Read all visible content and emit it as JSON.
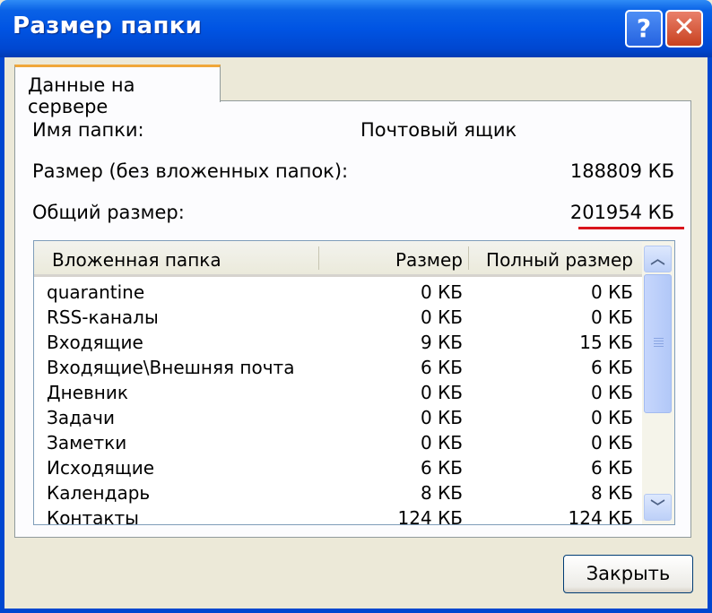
{
  "window": {
    "title": "Размер папки",
    "help_label": "?",
    "close_label": "✕"
  },
  "tab": {
    "label": "Данные на сервере"
  },
  "info": {
    "folder_name_label": "Имя папки:",
    "folder_name_value": "Почтовый ящик",
    "size_label": "Размер (без вложенных папок):",
    "size_value": "188809 КБ",
    "total_label": "Общий размер:",
    "total_value": "201954 КБ"
  },
  "table": {
    "headers": {
      "name": "Вложенная папка",
      "size": "Размер",
      "full": "Полный размер"
    },
    "rows": [
      {
        "name": "quarantine",
        "size": "0 КБ",
        "full": "0 КБ"
      },
      {
        "name": "RSS-каналы",
        "size": "0 КБ",
        "full": "0 КБ"
      },
      {
        "name": "Входящие",
        "size": "9 КБ",
        "full": "15 КБ"
      },
      {
        "name": "Входящие\\Внешняя почта",
        "size": "6 КБ",
        "full": "6 КБ"
      },
      {
        "name": "Дневник",
        "size": "0 КБ",
        "full": "0 КБ"
      },
      {
        "name": "Задачи",
        "size": "0 КБ",
        "full": "0 КБ"
      },
      {
        "name": "Заметки",
        "size": "0 КБ",
        "full": "0 КБ"
      },
      {
        "name": "Исходящие",
        "size": "6 КБ",
        "full": "6 КБ"
      },
      {
        "name": "Календарь",
        "size": "8 КБ",
        "full": "8 КБ"
      },
      {
        "name": "Контакты",
        "size": "124 КБ",
        "full": "124 КБ"
      }
    ]
  },
  "scrollbar": {
    "up_label": "︿",
    "down_label": "﹀"
  },
  "footer": {
    "close_button": "Закрыть"
  },
  "colors": {
    "titlebar": "#0054e3",
    "accent_underline": "#d9141c",
    "tab_highlight": "#f0a73a"
  }
}
